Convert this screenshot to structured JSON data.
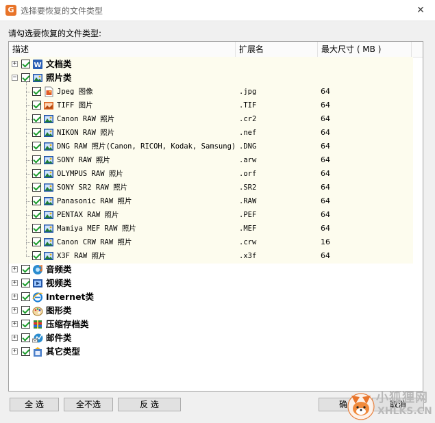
{
  "window": {
    "title": "选择要恢复的文件类型"
  },
  "instruction": "请勾选要恢复的文件类型:",
  "columns": {
    "desc": "描述",
    "ext": "扩展名",
    "size": "最大尺寸 ( MB )"
  },
  "categories_top": [
    {
      "label": "文档类",
      "icon": "word-doc-icon",
      "expander": "+"
    },
    {
      "label": "照片类",
      "icon": "photo-icon",
      "expander": "−"
    }
  ],
  "photo_items": [
    {
      "label": "Jpeg 图像",
      "ext": ".jpg",
      "size": "64",
      "icon": "jpeg-file-icon"
    },
    {
      "label": "TIFF 图片",
      "ext": ".TIF",
      "size": "64",
      "icon": "tiff-file-icon"
    },
    {
      "label": "Canon RAW 照片",
      "ext": ".cr2",
      "size": "64",
      "icon": "raw-photo-icon"
    },
    {
      "label": "NIKON RAW 照片",
      "ext": ".nef",
      "size": "64",
      "icon": "raw-photo-icon"
    },
    {
      "label": "DNG RAW 照片(Canon, RICOH, Kodak, Samsung)",
      "ext": ".DNG",
      "size": "64",
      "icon": "raw-photo-icon"
    },
    {
      "label": "SONY RAW 照片",
      "ext": ".arw",
      "size": "64",
      "icon": "raw-photo-icon"
    },
    {
      "label": "OLYMPUS RAW 照片",
      "ext": ".orf",
      "size": "64",
      "icon": "raw-photo-icon"
    },
    {
      "label": "SONY SR2 RAW 照片",
      "ext": ".SR2",
      "size": "64",
      "icon": "raw-photo-icon"
    },
    {
      "label": "Panasonic RAW 照片",
      "ext": ".RAW",
      "size": "64",
      "icon": "raw-photo-icon"
    },
    {
      "label": "PENTAX RAW 照片",
      "ext": ".PEF",
      "size": "64",
      "icon": "raw-photo-icon"
    },
    {
      "label": "Mamiya MEF RAW 照片",
      "ext": ".MEF",
      "size": "64",
      "icon": "raw-photo-icon"
    },
    {
      "label": "Canon CRW RAW 照片",
      "ext": ".crw",
      "size": "16",
      "icon": "raw-photo-icon"
    },
    {
      "label": "X3F RAW 照片",
      "ext": ".x3f",
      "size": "64",
      "icon": "raw-photo-icon"
    }
  ],
  "categories_bottom": [
    {
      "label": "音频类",
      "icon": "audio-icon",
      "expander": "+"
    },
    {
      "label": "视频类",
      "icon": "video-icon",
      "expander": "+"
    },
    {
      "label": "Internet类",
      "icon": "internet-explorer-icon",
      "expander": "+"
    },
    {
      "label": "图形类",
      "icon": "graphics-palette-icon",
      "expander": "+"
    },
    {
      "label": "压缩存档类",
      "icon": "archive-icon",
      "expander": "+"
    },
    {
      "label": "邮件类",
      "icon": "mail-icon",
      "expander": "+"
    },
    {
      "label": "其它类型",
      "icon": "other-types-icon",
      "expander": "+"
    }
  ],
  "buttons": {
    "select_all": "全  选",
    "select_none": "全不选",
    "invert": "反  选",
    "ok": "确",
    "cancel": "取消"
  },
  "watermark": {
    "text": "小狐狸网",
    "url_text": "XHLKS.CN"
  },
  "colors": {
    "accent": "#e8742a",
    "check": "#1a9c2b",
    "row_bg": "#fdfcee"
  }
}
